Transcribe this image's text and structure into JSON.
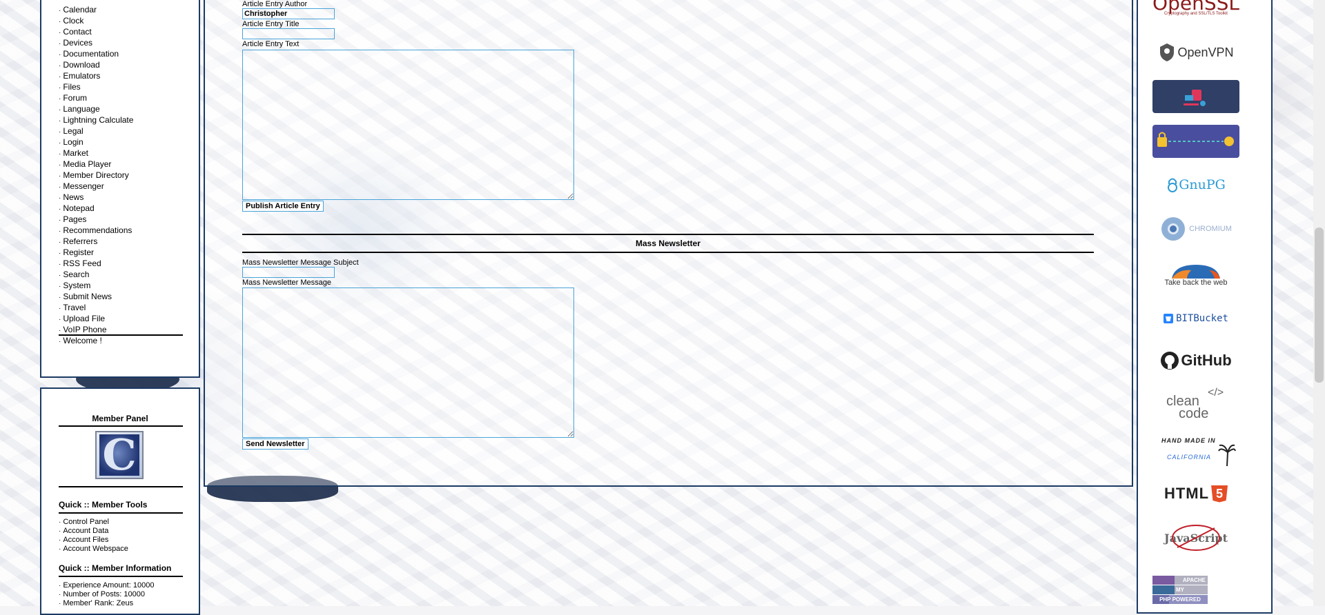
{
  "nav": {
    "items": [
      "Calendar",
      "Clock",
      "Contact",
      "Devices",
      "Documentation",
      "Download",
      "Emulators",
      "Files",
      "Forum",
      "Language",
      "Lightning Calculate",
      "Legal",
      "Login",
      "Market",
      "Media Player",
      "Member Directory",
      "Messenger",
      "News",
      "Notepad",
      "Pages",
      "Recommendations",
      "Referrers",
      "Register",
      "RSS Feed",
      "Search",
      "System",
      "Submit News",
      "Travel",
      "Upload File",
      "VoIP Phone",
      "Welcome !"
    ],
    "bullet": "·"
  },
  "member_panel": {
    "title": "Member Panel",
    "avatar_letter": "C",
    "tools_heading": "Quick :: Member Tools",
    "tools": [
      "Control Panel",
      "Account Data",
      "Account Files",
      "Account Webspace"
    ],
    "info_heading": "Quick :: Member Information",
    "info": [
      "Experience Amount: 10000",
      "Number of Posts: 10000",
      "Member' Rank: Zeus"
    ]
  },
  "article": {
    "author_label": "Article Entry Author",
    "author_value": "Christopher",
    "title_label": "Article Entry Title",
    "title_value": "",
    "text_label": "Article Entry Text",
    "publish_button": "Publish Article Entry"
  },
  "newsletter": {
    "section_title": "Mass Newsletter",
    "subject_label": "Mass Newsletter Message Subject",
    "subject_value": "",
    "message_label": "Mass Newsletter Message",
    "send_button": "Send Newsletter"
  },
  "sidebar_logos": {
    "openssl": "OpenSSL",
    "openssl_tagline": "Cryptography and SSL/TLS Toolkit",
    "openvpn": "OpenVPN",
    "gnupg": "GnuPG",
    "chromium": "CHROMIUM",
    "firefox_tagline": "Take back the web",
    "bitbucket": "BITBucket",
    "github": "GitHub",
    "cleancode_1": "clean",
    "cleancode_2": "code",
    "cleancode_tag": "</>",
    "handmade_1": "HAND MADE IN",
    "handmade_2": "CALIFORNIA",
    "html5": "HTML",
    "html5_num": "5",
    "javascript": "JavaScript",
    "apache": "APACHE",
    "mysql": "MY",
    "php": "PHP POWERED"
  },
  "colors": {
    "panel_border": "#1b3a63",
    "input_border": "#49a3d9",
    "openssl_red": "#8b1a1a",
    "html5_orange": "#e44d26"
  }
}
